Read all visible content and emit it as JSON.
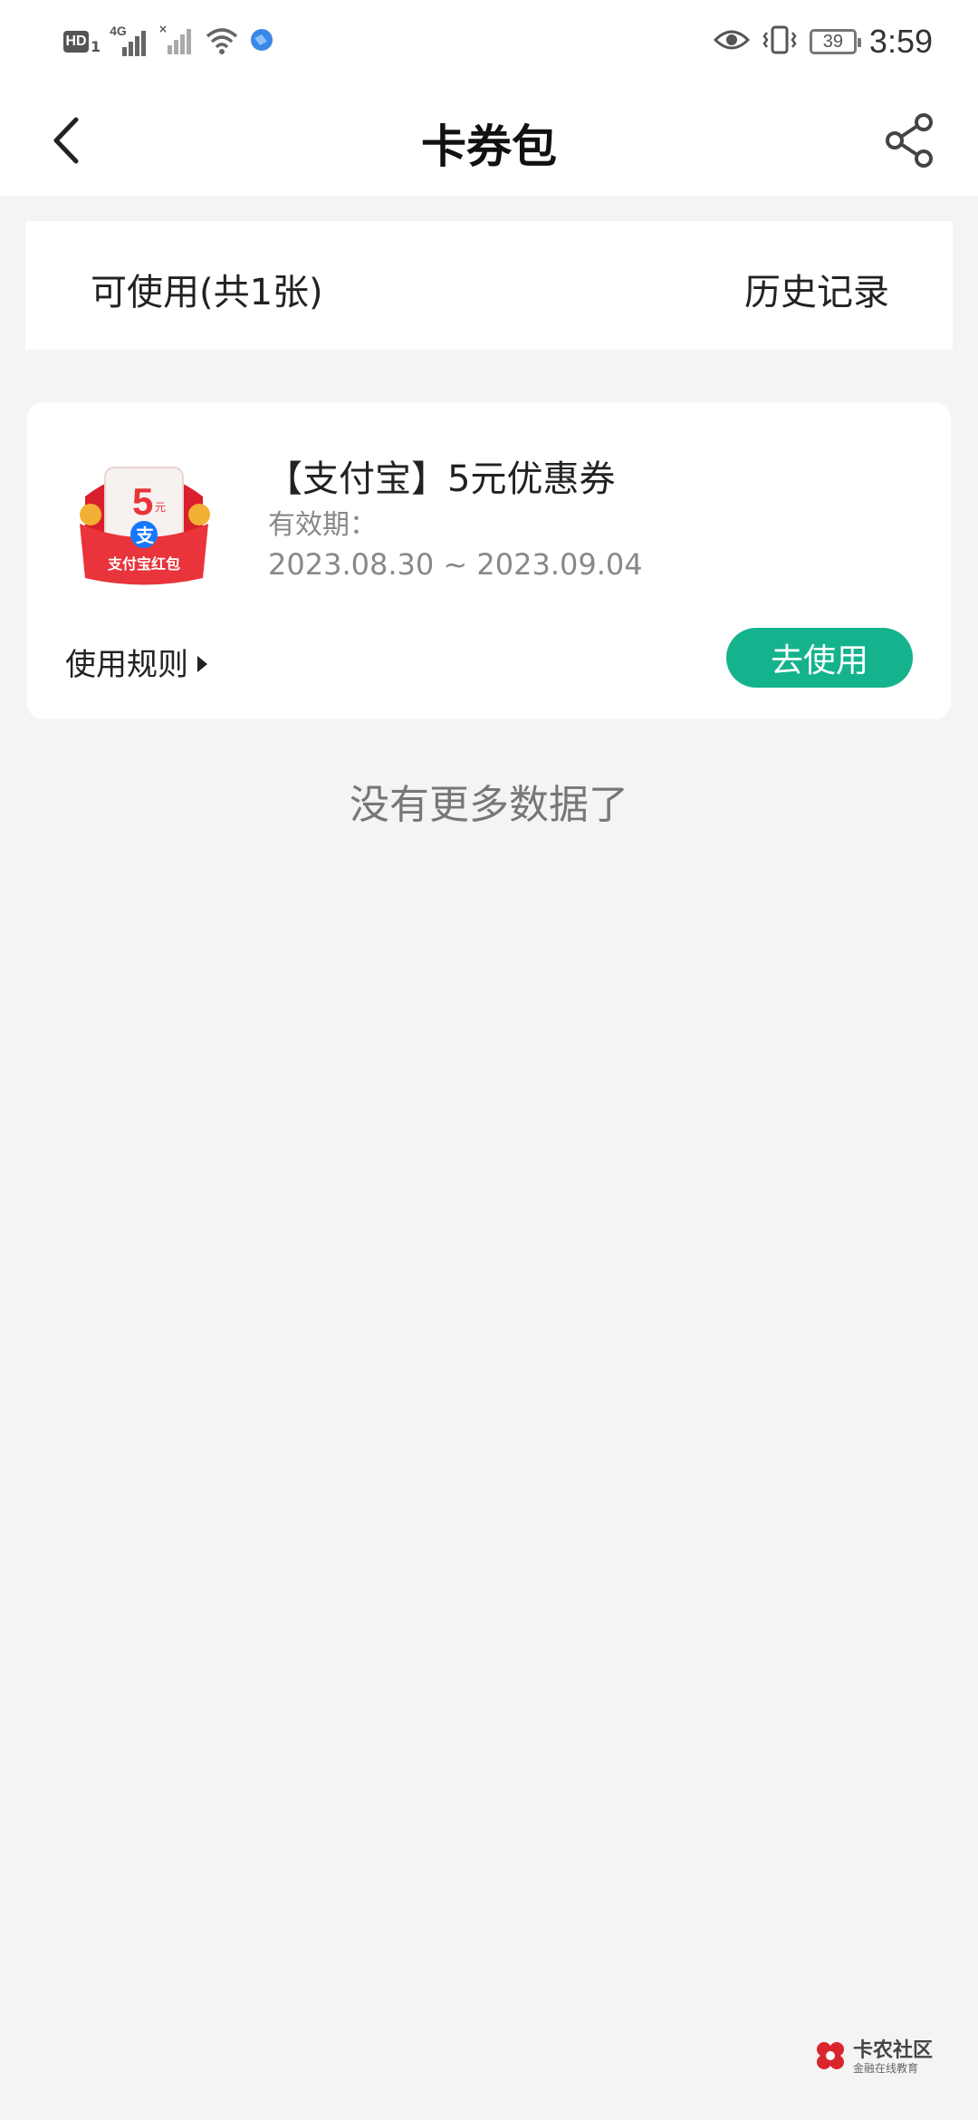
{
  "status_bar": {
    "hd_label": "HD",
    "sim_index": "1",
    "network_type": "4G",
    "battery_level": "39",
    "time": "3:59"
  },
  "header": {
    "title": "卡券包",
    "back_icon": "chevron-left-icon",
    "share_icon": "share-icon"
  },
  "tabs": {
    "available": "可使用(共1张)",
    "history": "历史记录"
  },
  "coupon": {
    "badge_value": "5",
    "badge_unit": "元",
    "badge_logo": "支",
    "badge_caption": "支付宝红包",
    "title": "【支付宝】5元优惠券",
    "validity_label": "有效期：",
    "validity_range": "2023.08.30 ~ 2023.09.04",
    "rules_label": "使用规则",
    "use_button": "去使用"
  },
  "footer": {
    "no_more": "没有更多数据了"
  },
  "watermark": {
    "name": "卡农社区",
    "sub": "金融在线教育"
  },
  "colors": {
    "accent_green": "#14b38d",
    "page_bg": "#f4f4f4",
    "card_bg": "#ffffff",
    "coupon_red": "#e8343a"
  }
}
